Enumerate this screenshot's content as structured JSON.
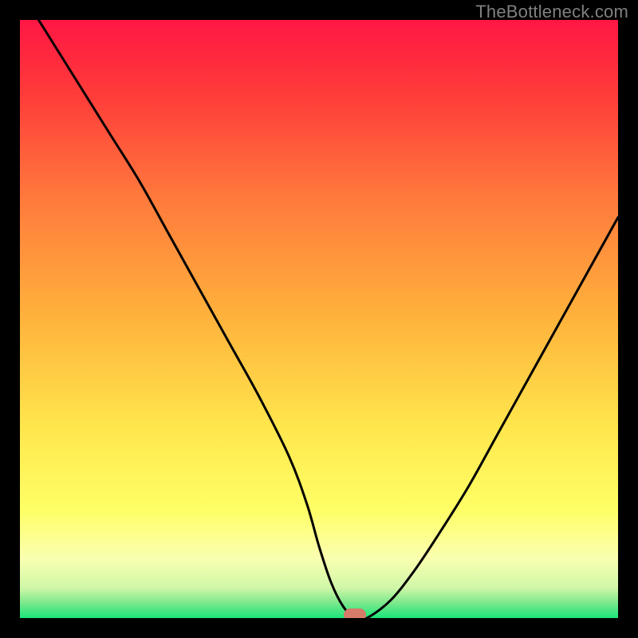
{
  "watermark": "TheBottleneck.com",
  "chart_data": {
    "type": "line",
    "title": "",
    "xlabel": "",
    "ylabel": "",
    "xlim": [
      0,
      100
    ],
    "ylim": [
      0,
      100
    ],
    "legend": false,
    "grid": false,
    "background": {
      "type": "vertical-gradient",
      "description": "Red at top through orange, yellow, pale yellow-green to green at very bottom, representing bottleneck severity (red=bad, green=good)",
      "stops": [
        {
          "offset": 0.0,
          "color": "#ff1744"
        },
        {
          "offset": 0.12,
          "color": "#ff3a3a"
        },
        {
          "offset": 0.3,
          "color": "#ff7a3c"
        },
        {
          "offset": 0.5,
          "color": "#ffb33c"
        },
        {
          "offset": 0.68,
          "color": "#ffe64d"
        },
        {
          "offset": 0.82,
          "color": "#ffff66"
        },
        {
          "offset": 0.9,
          "color": "#faffb0"
        },
        {
          "offset": 0.95,
          "color": "#cff7a8"
        },
        {
          "offset": 0.975,
          "color": "#7be88c"
        },
        {
          "offset": 1.0,
          "color": "#19e57a"
        }
      ]
    },
    "series": [
      {
        "name": "bottleneck-curve",
        "color": "#000000",
        "x": [
          0,
          5,
          10,
          15,
          20,
          25,
          30,
          35,
          40,
          45,
          48,
          50,
          52,
          54,
          56,
          58,
          62,
          66,
          70,
          75,
          80,
          85,
          90,
          95,
          100
        ],
        "y": [
          105,
          97,
          89,
          81,
          73,
          64,
          55,
          46,
          37,
          27,
          19,
          12,
          6,
          2,
          0,
          0,
          3,
          8,
          14,
          22,
          31,
          40,
          49,
          58,
          67
        ]
      }
    ],
    "marker": {
      "name": "optimal-point",
      "x": 56,
      "y": 0,
      "color": "#d57b6a",
      "shape": "rounded-rect"
    }
  }
}
